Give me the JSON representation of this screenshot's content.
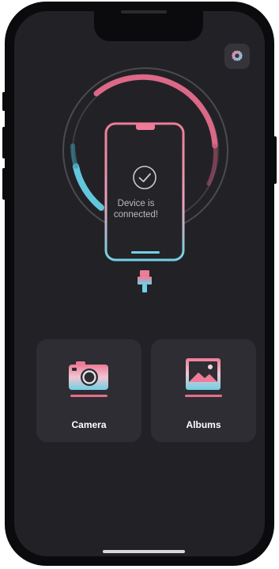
{
  "status": {
    "line1": "Device is",
    "line2": "connected!"
  },
  "cards": {
    "camera": {
      "label": "Camera",
      "icon": "camera-icon"
    },
    "albums": {
      "label": "Albums",
      "icon": "image-icon"
    }
  },
  "header": {
    "settings_icon": "gear-icon"
  },
  "colors": {
    "background": "#222226",
    "card": "#2d2d33",
    "accent_pink": "#e66d8c",
    "accent_cyan": "#62c7dd"
  }
}
